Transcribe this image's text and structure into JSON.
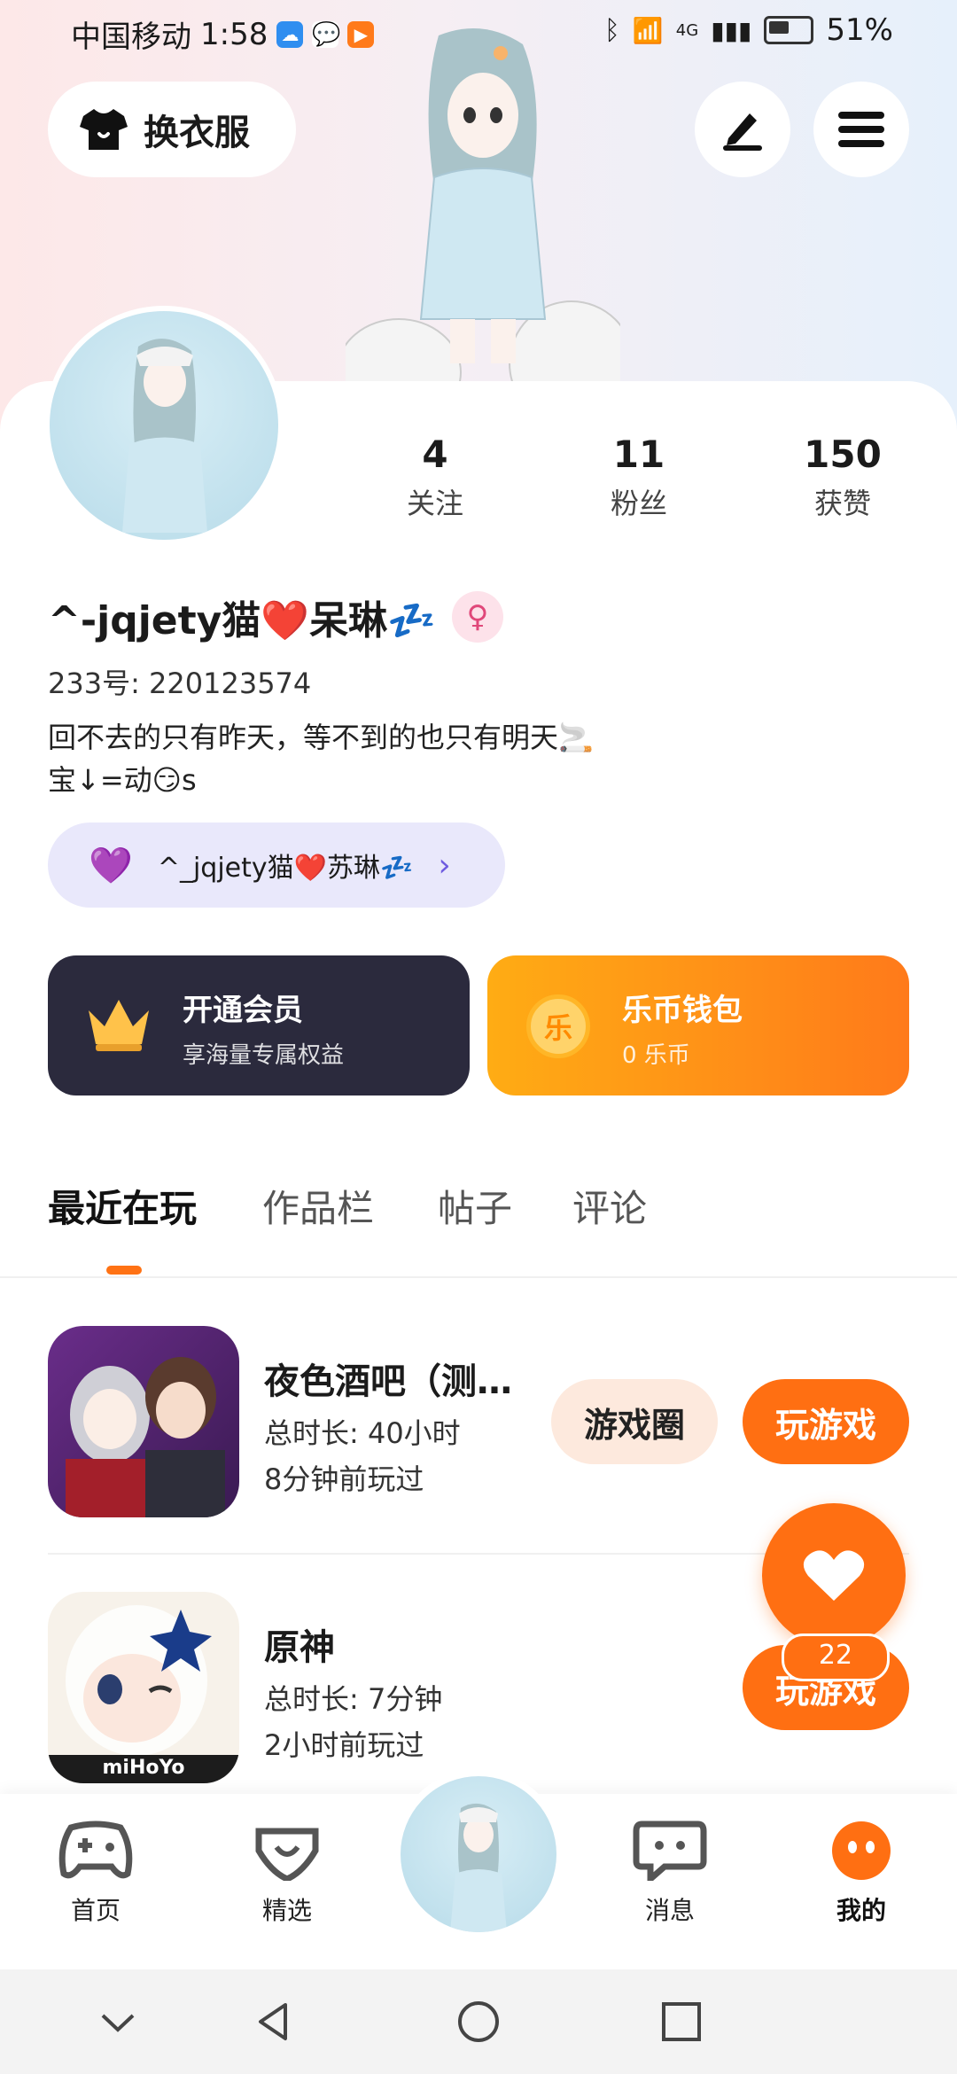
{
  "status_bar": {
    "carrier": "中国移动",
    "time": "1:58",
    "network": "4G",
    "battery": "51%"
  },
  "top": {
    "outfit_label": "换衣服",
    "edit_icon": "pen-icon",
    "menu_icon": "hamburger-icon"
  },
  "profile": {
    "stats": [
      {
        "value": "4",
        "label": "关注"
      },
      {
        "value": "11",
        "label": "粉丝"
      },
      {
        "value": "150",
        "label": "获赞"
      }
    ],
    "username": "^-jqjety猫❤️呆琳💤",
    "uid": "233号:  220123574",
    "bio_line1": "回不去的只有昨天，等不到的也只有明天🚬",
    "bio_line2": "宝↓=动😏s",
    "cp_name": "^_jqjety猫❤️苏琳💤"
  },
  "cards": {
    "vip_title": "开通会员",
    "vip_sub": "享海量专属权益",
    "coin_title": "乐币钱包",
    "coin_sub": "0 乐币",
    "coin_glyph": "乐"
  },
  "tabs": [
    {
      "label": "最近在玩"
    },
    {
      "label": "作品栏"
    },
    {
      "label": "帖子"
    },
    {
      "label": "评论"
    }
  ],
  "games": [
    {
      "name": "夜色酒吧（测…",
      "playtime": "总时长:  40小时",
      "last": "8分钟前玩过",
      "circle_label": "游戏圈",
      "play_label": "玩游戏"
    },
    {
      "name": "原神",
      "playtime": "总时长:  7分钟",
      "last": "2小时前玩过",
      "play_label": "玩游戏",
      "icon_text": "miHoYo"
    }
  ],
  "like": {
    "count": "22"
  },
  "bottom_nav": [
    {
      "label": "首页",
      "icon": "gamepad-icon"
    },
    {
      "label": "精选",
      "icon": "heart-shield-icon"
    },
    {
      "label": "",
      "icon": "avatar-center"
    },
    {
      "label": "消息",
      "icon": "chat-bubble-icon"
    },
    {
      "label": "我的",
      "icon": "face-icon"
    }
  ],
  "colors": {
    "accent": "#ff6f12",
    "vip_bg": "#2b2a3d",
    "cp_pill": "#e9e8fb"
  }
}
